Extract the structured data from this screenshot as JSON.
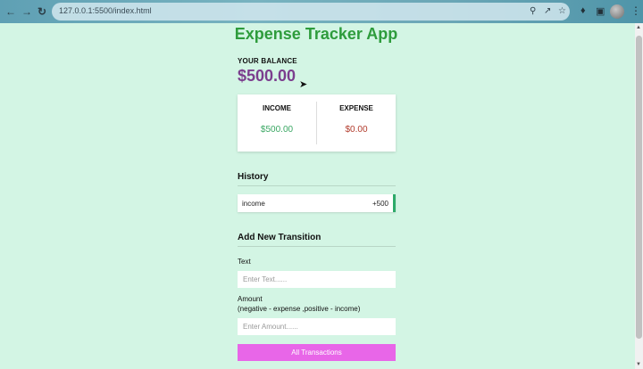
{
  "browser": {
    "url": "127.0.0.1:5500/index.html",
    "icons": [
      "back-icon",
      "forward-icon",
      "reload-icon",
      "zoom-icon",
      "share-icon",
      "bookmark-star-icon",
      "extensions-icon",
      "side-panel-icon",
      "profile-avatar",
      "menu-icon"
    ]
  },
  "app": {
    "title": "Expense Tracker App",
    "balance_label": "YOUR BALANCE",
    "balance": "$500.00",
    "summary": {
      "income_label": "INCOME",
      "income_value": "$500.00",
      "expense_label": "EXPENSE",
      "expense_value": "$0.00"
    },
    "history": {
      "title": "History",
      "items": [
        {
          "text": "income",
          "amount": "+500",
          "type": "income"
        }
      ]
    },
    "form": {
      "title": "Add New Transition",
      "text_label": "Text",
      "text_placeholder": "Enter Text......",
      "amount_label": "Amount",
      "amount_hint": "(negative - expense ,positive - income)",
      "amount_placeholder": "Enter Amount......",
      "submit_label": "All Transactions"
    }
  },
  "colors": {
    "page_bg": "#d3f5e4",
    "title": "#2e9c3c",
    "balance": "#7b3e8e",
    "income": "#3aa763",
    "expense": "#b23b2c",
    "button": "#e866e8"
  }
}
